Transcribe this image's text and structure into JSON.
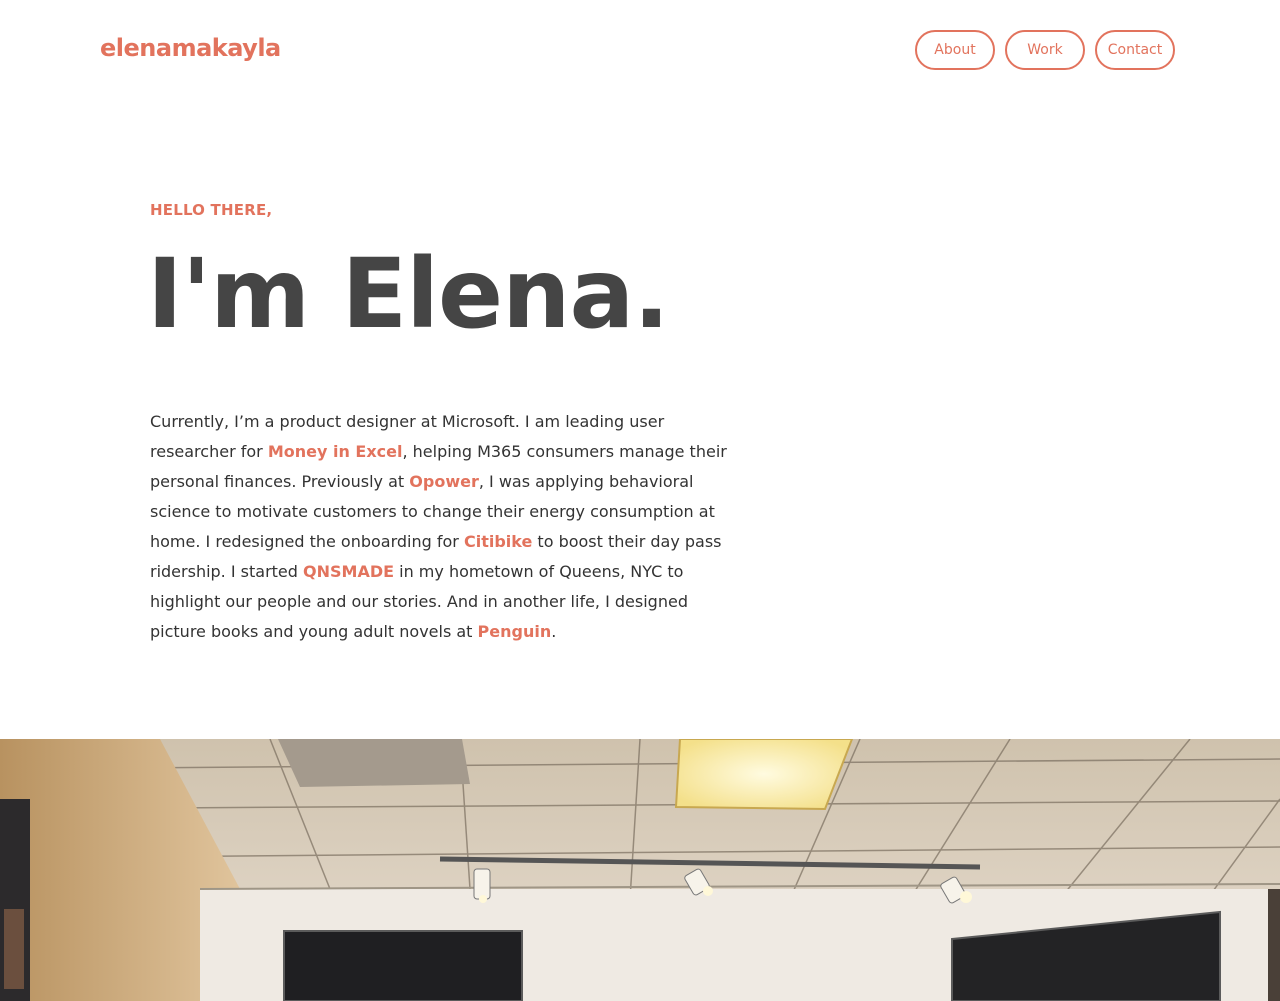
{
  "header": {
    "logo": "elenamakayla",
    "nav": [
      {
        "label": "About"
      },
      {
        "label": "Work"
      },
      {
        "label": "Contact"
      }
    ]
  },
  "hero": {
    "greeting": "HELLO THERE,",
    "headline": "I'm Elena.",
    "bio": {
      "t1": "Currently, I’m a product designer at Microsoft. I am leading user researcher for ",
      "link1": "Money in Excel",
      "t2": ", helping M365 consumers manage their personal finances. Previously at ",
      "link2": "Opower",
      "t3": ", I was applying behavioral science to motivate customers to change their energy consumption at home. I redesigned the onboarding for ",
      "link3": "Citibike",
      "t4": " to boost their day pass ridership. I started ",
      "link4": "QNSMADE",
      "t5": " in my hometown of Queens, NYC to highlight our people and our stories. And in another life, I designed picture books and young adult novels at ",
      "link5": "Penguin",
      "t6": "."
    }
  },
  "colors": {
    "accent": "#e2735d",
    "heading": "#454545",
    "body_text": "#333333",
    "background": "#ffffff"
  }
}
